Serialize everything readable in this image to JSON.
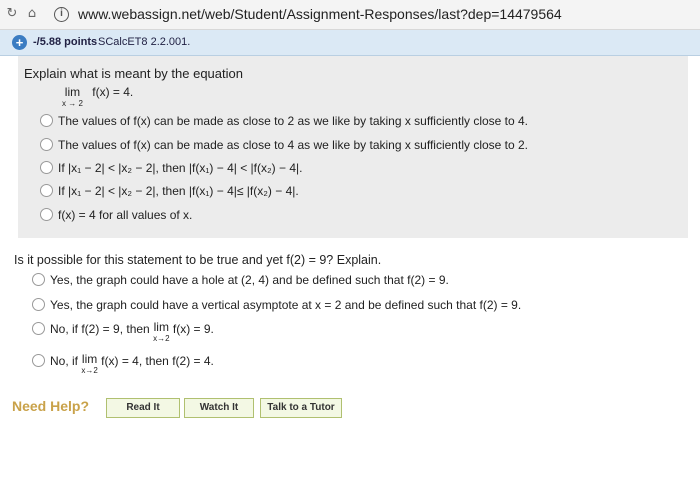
{
  "browser": {
    "url": "www.webassign.net/web/Student/Assignment-Responses/last?dep=14479564"
  },
  "question_header": {
    "points": "-/5.88 points",
    "reference": "SCalcET8 2.2.001."
  },
  "part1": {
    "prompt": "Explain what is meant by the equation",
    "equation": {
      "lim": "lim",
      "sub": "x → 2",
      "expr": "f(x) = 4."
    },
    "options": [
      {
        "label": "The values of f(x) can be made as close to 2 as we like by taking x sufficiently close to 4."
      },
      {
        "label": "The values of f(x) can be made as close to 4 as we like by taking x sufficiently close to 2."
      },
      {
        "label": "If |x₁ − 2| < |x₂ − 2|, then |f(x₁) − 4| < |f(x₂) − 4|."
      },
      {
        "label": "If |x₁ − 2| < |x₂ − 2|, then |f(x₁) − 4|≤ |f(x₂) − 4|."
      },
      {
        "label": "f(x) = 4 for all values of x."
      }
    ]
  },
  "part2": {
    "prompt": "Is it possible for this statement to be true and yet f(2) = 9? Explain.",
    "options": [
      {
        "label": "Yes, the graph could have a hole at (2, 4) and be defined such that f(2) = 9."
      },
      {
        "label": "Yes, the graph could have a vertical asymptote at x = 2 and be defined such that f(2) = 9."
      },
      {
        "pre": "No, if f(2) = 9, then",
        "lim": "lim",
        "sub": "x→2",
        "post": "f(x) = 9."
      },
      {
        "pre": "No, if",
        "lim": "lim",
        "sub": "x→2",
        "post": "f(x) = 4, then f(2) = 4."
      }
    ]
  },
  "help": {
    "label": "Need Help?",
    "buttons": [
      "Read It",
      "Watch It",
      "Talk to a Tutor"
    ]
  }
}
